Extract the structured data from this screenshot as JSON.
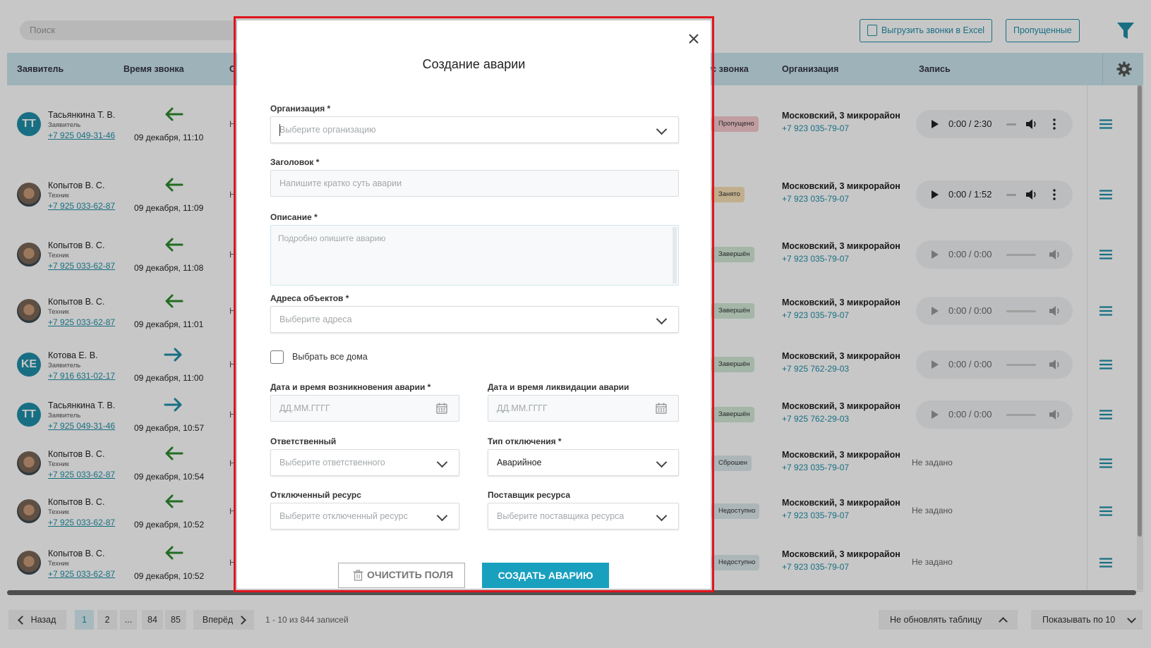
{
  "toolbar": {
    "search_placeholder": "Поиск",
    "export_label": "Выгрузить звонки в Excel",
    "missed_label": "Пропущенные"
  },
  "table": {
    "columns": [
      "Заявитель",
      "Время звонка",
      "С",
      "Статус звонка",
      "Организация",
      "Запись"
    ],
    "rows": [
      {
        "avatar": "TT",
        "name": "Тасьянкина Т. В.",
        "role": "Заявитель",
        "phone": "+7 925 049-31-46",
        "direction": "incoming",
        "time": "09 декабря, 11:10",
        "stub": "Н",
        "status": "Пропущено",
        "org": "Московский, 3 микрорайон",
        "org_phone": "+7 923 035-79-07",
        "record": "0:00 / 2:30"
      },
      {
        "avatar": "photo",
        "name": "Копытов В. С.",
        "role": "Техник",
        "phone": "+7 925 033-62-87",
        "direction": "incoming",
        "time": "09 декабря, 11:09",
        "stub": "Н",
        "status": "Занято",
        "org": "Московский, 3 микрорайон",
        "org_phone": "+7 923 035-79-07",
        "record": "0:00 / 1:52"
      },
      {
        "avatar": "photo",
        "name": "Копытов В. С.",
        "role": "Техник",
        "phone": "+7 925 033-62-87",
        "direction": "incoming",
        "time": "09 декабря, 11:08",
        "stub": "Н",
        "status": "Завершён",
        "org": "Московский, 3 микрорайон",
        "org_phone": "+7 923 035-79-07",
        "record": "0:00 / 0:00"
      },
      {
        "avatar": "photo",
        "name": "Копытов В. С.",
        "role": "Техник",
        "phone": "+7 925 033-62-87",
        "direction": "incoming",
        "time": "09 декабря, 11:01",
        "stub": "Н",
        "status": "Завершён",
        "org": "Московский, 3 микрорайон",
        "org_phone": "+7 923 035-79-07",
        "record": "0:00 / 0:00"
      },
      {
        "avatar": "KE",
        "name": "Котова Е. В.",
        "role": "Заявитель",
        "phone": "+7 916 631-02-17",
        "direction": "outgoing",
        "time": "09 декабря, 11:00",
        "stub": "Н",
        "status": "Завершён",
        "org": "Московский, 3 микрорайон",
        "org_phone": "+7 925 762-29-03",
        "record": "0:00 / 0:00"
      },
      {
        "avatar": "TT",
        "name": "Тасьянкина Т. В.",
        "role": "Заявитель",
        "phone": "+7 925 049-31-46",
        "direction": "outgoing",
        "time": "09 декабря, 10:57",
        "stub": "Н",
        "status": "Завершён",
        "org": "Московский, 3 микрорайон",
        "org_phone": "+7 925 762-29-03",
        "record": "0:00 / 0:00"
      },
      {
        "avatar": "photo",
        "name": "Копытов В. С.",
        "role": "Техник",
        "phone": "+7 925 033-62-87",
        "direction": "incoming",
        "time": "09 декабря, 10:54",
        "stub": "Н",
        "status": "Сброшен",
        "org": "Московский, 3 микрорайон",
        "org_phone": "+7 923 035-79-07",
        "record": "Не задано"
      },
      {
        "avatar": "photo",
        "name": "Копытов В. С.",
        "role": "Техник",
        "phone": "+7 925 033-62-87",
        "direction": "incoming",
        "time": "09 декабря, 10:52",
        "stub": "Н",
        "status": "Недоступно",
        "org": "Московский, 3 микрорайон",
        "org_phone": "+7 923 035-79-07",
        "record": "Не задано"
      },
      {
        "avatar": "photo",
        "name": "Копытов В. С.",
        "role": "Техник",
        "phone": "+7 925 033-62-87",
        "direction": "incoming",
        "time": "09 декабря, 10:52",
        "stub": "Н",
        "status": "Недоступно",
        "org": "Московский, 3 микрорайон",
        "org_phone": "+7 923 035-79-07",
        "record": "Не задано"
      }
    ]
  },
  "pagination": {
    "prev": "Назад",
    "pages": [
      "1",
      "2",
      "...",
      "84",
      "85"
    ],
    "next": "Вперёд",
    "records_info": "1 - 10 из 844 записей",
    "refresh_label": "Не обновлять таблицу",
    "page_size_label": "Показывать по 10"
  },
  "modal": {
    "title": "Создание аварии",
    "organization_label": "Организация *",
    "organization_placeholder": "Выберите организацию",
    "header_label": "Заголовок *",
    "header_placeholder": "Напишите кратко суть аварии",
    "description_label": "Описание *",
    "description_placeholder": "Подробно опишите аварию",
    "addresses_label": "Адреса объектов *",
    "addresses_placeholder": "Выберите адреса",
    "select_all_label": "Выбрать все дома",
    "start_label": "Дата и время возникновения аварии *",
    "start_placeholder": "ДД.ММ.ГГГГ",
    "end_label": "Дата и время ликвидации аварии",
    "end_placeholder": "ДД.ММ.ГГГГ",
    "responsible_label": "Ответственный",
    "responsible_placeholder": "Выберите ответственного",
    "shutdown_type_label": "Тип отключения *",
    "shutdown_type_value": "Аварийное",
    "resource_label": "Отключенный ресурс",
    "resource_placeholder": "Выберите отключенный ресурс",
    "provider_label": "Поставщик ресурса",
    "provider_placeholder": "Выберите поставщика ресурса",
    "clear_button": "ОЧИСТИТЬ ПОЛЯ",
    "create_button": "СОЗДАТЬ АВАРИЮ"
  },
  "colors": {
    "accent": "#1f8fa8",
    "header_bg": "#c9e4ee",
    "highlight": "#e0141e",
    "status_missed": "#f6c9cf",
    "status_busy": "#f6dfb4",
    "status_done": "#d2e9d8",
    "status_other": "#dde8ec"
  }
}
